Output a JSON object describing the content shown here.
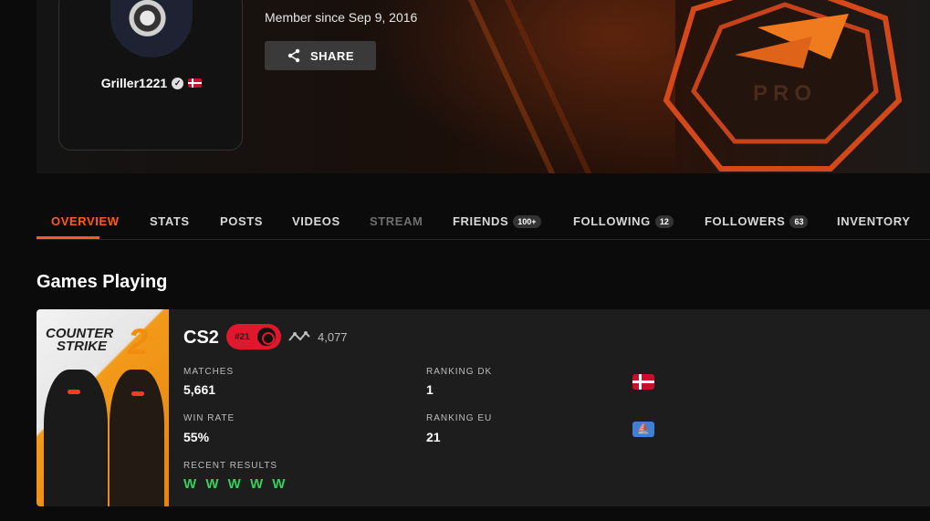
{
  "profile": {
    "username": "Griller1221",
    "member_since": "Member since Sep 9, 2016",
    "share_label": "SHARE",
    "banner_logo_text": "PRO"
  },
  "tabs": [
    {
      "label": "OVERVIEW",
      "state": "active"
    },
    {
      "label": "STATS",
      "state": "normal"
    },
    {
      "label": "POSTS",
      "state": "normal"
    },
    {
      "label": "VIDEOS",
      "state": "normal"
    },
    {
      "label": "STREAM",
      "state": "disabled"
    },
    {
      "label": "FRIENDS",
      "badge": "100+",
      "state": "normal"
    },
    {
      "label": "FOLLOWING",
      "badge": "12",
      "state": "normal"
    },
    {
      "label": "FOLLOWERS",
      "badge": "63",
      "state": "normal"
    },
    {
      "label": "INVENTORY",
      "state": "normal"
    }
  ],
  "section": {
    "title": "Games Playing"
  },
  "game": {
    "art_title_line1": "COUNTER",
    "art_title_line2": "STRIKE",
    "art_number": "2",
    "name": "CS2",
    "rank_label": "#21",
    "elo": "4,077",
    "stats": {
      "matches_label": "MATCHES",
      "matches_value": "5,661",
      "winrate_label": "WIN RATE",
      "winrate_value": "55%",
      "recent_label": "RECENT RESULTS",
      "recent_value": "W W W W W",
      "ranking_dk_label": "RANKING DK",
      "ranking_dk_value": "1",
      "ranking_eu_label": "RANKING EU",
      "ranking_eu_value": "21"
    }
  },
  "colors": {
    "accent": "#ff5a1f",
    "rank_red": "#e0182d",
    "win_green": "#34d15a",
    "card_bg": "#1d1d1d"
  },
  "icons": [
    "share-icon",
    "verified-icon",
    "denmark-flag-icon",
    "rank-icon",
    "elo-graph-icon",
    "europe-flag-icon"
  ]
}
